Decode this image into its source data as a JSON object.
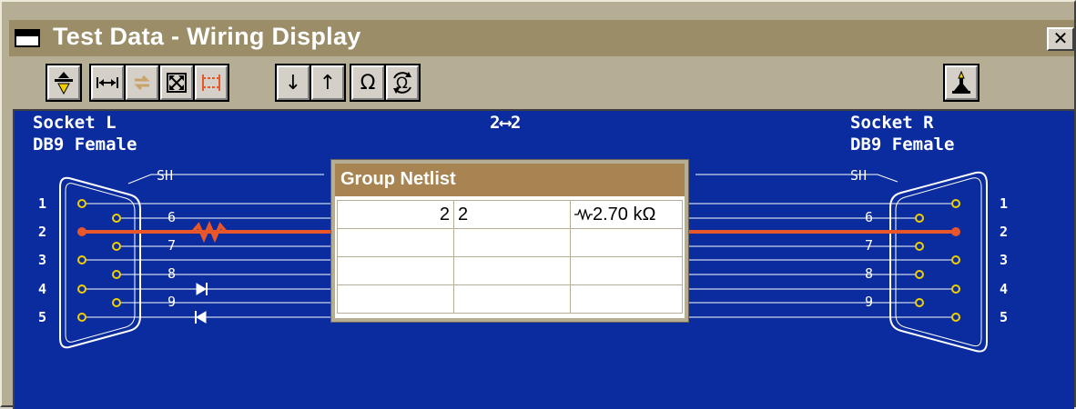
{
  "window": {
    "title": "Test Data - Wiring Display",
    "close_label": "✕"
  },
  "toolbar": {
    "buttons": [
      {
        "name": "probe-icon"
      },
      {
        "name": "fit-width-icon"
      },
      {
        "name": "swap-icon"
      },
      {
        "name": "expand-icon"
      },
      {
        "name": "connect-icon"
      },
      {
        "name": "down-arrow-icon",
        "label": "↓"
      },
      {
        "name": "up-arrow-icon",
        "label": "↑"
      },
      {
        "name": "ohm-icon",
        "label": "Ω"
      },
      {
        "name": "ohm-cycle-icon"
      },
      {
        "name": "ground-probe-icon"
      }
    ]
  },
  "wiring": {
    "left_connector": {
      "socket": "Socket L",
      "type": "DB9 Female"
    },
    "right_connector": {
      "socket": "Socket R",
      "type": "DB9 Female"
    },
    "connection": "2⟷2",
    "shield_label": "SH",
    "outer_pins": [
      "1",
      "2",
      "3",
      "4",
      "5"
    ],
    "inner_pins": [
      "6",
      "7",
      "8",
      "9"
    ],
    "highlight_color": "#e8562a",
    "background_color": "#0a2c9e"
  },
  "netlist": {
    "title": "Group Netlist",
    "rows": [
      {
        "left": "2",
        "right": "2",
        "value": "2.70 kΩ"
      },
      {
        "left": "",
        "right": "",
        "value": ""
      },
      {
        "left": "",
        "right": "",
        "value": ""
      },
      {
        "left": "",
        "right": "",
        "value": ""
      }
    ]
  }
}
